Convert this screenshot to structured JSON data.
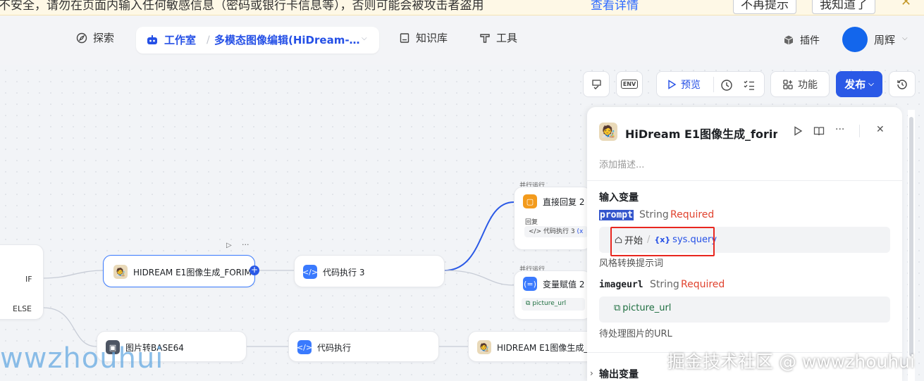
{
  "warning": {
    "message": "不安全，请勿在页面内输入任何敏感信息（密码或银行卡信息等），否则可能会被攻击者盗用",
    "details_link": "查看详情",
    "dont_remind": "不再提示",
    "got_it": "我知道了",
    "close": "✕"
  },
  "nav": {
    "explore": "探索",
    "workspace": "工作室",
    "app_name": "多模态图像编辑(HiDream-…",
    "knowledge": "知识库",
    "tools": "工具",
    "plugins": "插件",
    "user_name": "周辉"
  },
  "toolbar": {
    "preview": "预览",
    "features": "功能",
    "publish": "发布",
    "env": "ENV"
  },
  "nodes": {
    "if_label": "IF",
    "else_label": "ELSE",
    "hidream_main": "HIDREAM E1图像生成_FORIM",
    "code3": "代码执行 3",
    "reply2": "直接回复 2",
    "reply2_sub": "回复",
    "reply2_ref": "代码执行 3",
    "reply2_ref_tag": "(x",
    "assign2": "变量赋值 2",
    "assign2_var": "picture_url",
    "img_b64": "图片转BASE64",
    "code": "代码执行",
    "hidream_b": "HIDREAM E1图像生成_F",
    "parallel1": "并行运行",
    "parallel2": "并行运行"
  },
  "panel": {
    "title": "HiDream E1图像生成_forim",
    "description_placeholder": "添加描述...",
    "inputs_title": "输入变量",
    "prompt_name": "prompt",
    "prompt_type": "String",
    "prompt_required": "Required",
    "prompt_source_node": "开始",
    "prompt_source_sep": "/",
    "prompt_source_var_tag": "{x}",
    "prompt_source_var": "sys.query",
    "prompt_hint": "风格转换提示词",
    "imageurl_name": "imageurl",
    "imageurl_type": "String",
    "imageurl_required": "Required",
    "imageurl_value": "picture_url",
    "imageurl_hint": "待处理图片的URL",
    "outputs_title": "输出变量"
  },
  "watermarks": {
    "left": "wwzhouhui",
    "right": "掘金技术社区 @ wwwzhouhui"
  },
  "colors": {
    "accent": "#2a59e6",
    "required": "#e0432f",
    "highlight_box": "#e8271f",
    "edge": "#3a7afe"
  }
}
